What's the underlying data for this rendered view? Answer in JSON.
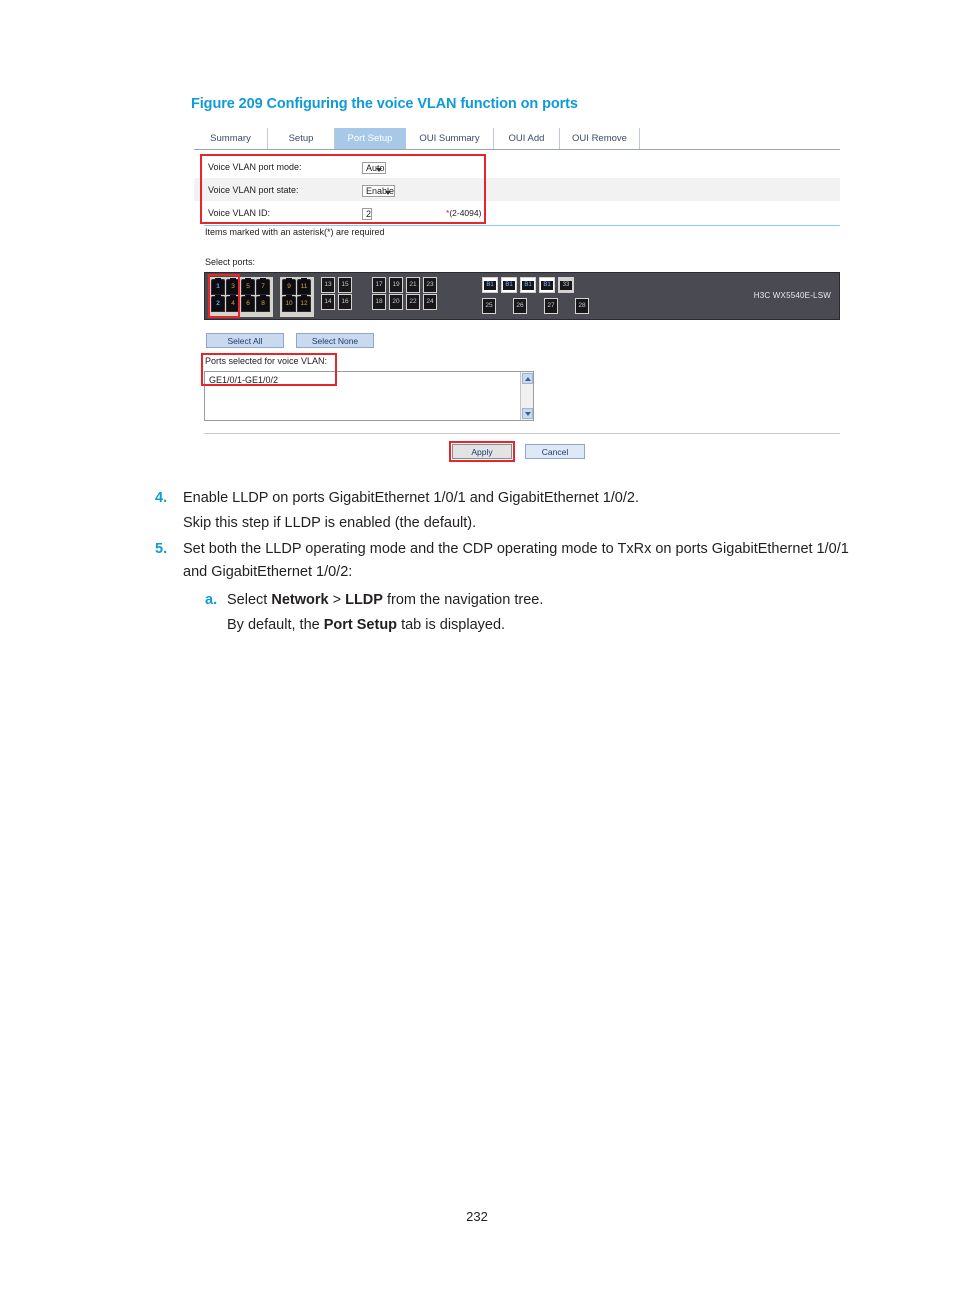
{
  "figure": {
    "caption": "Figure 209 Configuring the voice VLAN function on ports",
    "tabs": [
      {
        "label": "Summary",
        "active": false
      },
      {
        "label": "Setup",
        "active": false
      },
      {
        "label": "Port Setup",
        "active": true
      },
      {
        "label": "OUI Summary",
        "active": false
      },
      {
        "label": "OUI Add",
        "active": false
      },
      {
        "label": "OUI Remove",
        "active": false
      }
    ],
    "form": {
      "rows": [
        {
          "label": "Voice VLAN port mode:",
          "control": "select",
          "value": "Auto",
          "hint": ""
        },
        {
          "label": "Voice VLAN port state:",
          "control": "select",
          "value": "Enable",
          "hint": ""
        },
        {
          "label": "Voice VLAN ID:",
          "control": "text",
          "value": "2",
          "hint": "(2-4094)",
          "hint_star": "*"
        }
      ],
      "required_note": "Items marked with an asterisk(*) are required"
    },
    "ports": {
      "section_label": "Select ports:",
      "device_label": "H3C WX5540E-LSW",
      "groups": [
        {
          "type": "rj45",
          "shell": true,
          "columns": [
            {
              "top": "1",
              "bottom": "2",
              "top_selected": true,
              "bottom_selected": true
            },
            {
              "top": "3",
              "bottom": "4",
              "top_selected": false,
              "bottom_selected": false
            },
            {
              "top": "5",
              "bottom": "6",
              "top_selected": false,
              "bottom_selected": false
            },
            {
              "top": "7",
              "bottom": "8",
              "top_selected": false,
              "bottom_selected": false
            }
          ]
        },
        {
          "type": "rj45",
          "shell": true,
          "columns": [
            {
              "top": "9",
              "bottom": "10",
              "top_selected": false,
              "bottom_selected": false
            },
            {
              "top": "11",
              "bottom": "12",
              "top_selected": false,
              "bottom_selected": false
            }
          ]
        },
        {
          "type": "framed",
          "shell": false,
          "columns": [
            {
              "top": "13",
              "bottom": "14",
              "top_selected": false,
              "bottom_selected": false
            },
            {
              "top": "15",
              "bottom": "16",
              "top_selected": false,
              "bottom_selected": false
            }
          ]
        },
        {
          "type": "framed",
          "shell": false,
          "columns": [
            {
              "top": "17",
              "bottom": "18",
              "top_selected": false,
              "bottom_selected": false
            },
            {
              "top": "19",
              "bottom": "20",
              "top_selected": false,
              "bottom_selected": false
            },
            {
              "top": "21",
              "bottom": "22",
              "top_selected": false,
              "bottom_selected": false
            },
            {
              "top": "23",
              "bottom": "24",
              "top_selected": false,
              "bottom_selected": false
            }
          ]
        }
      ],
      "sfp_ports": [
        "B1",
        "B1",
        "B1",
        "B1"
      ],
      "uplink_port": "33",
      "bottom_row_ports": [
        "25",
        "26",
        "27",
        "28"
      ],
      "select_all_label": "Select All",
      "select_none_label": "Select None"
    },
    "selection": {
      "label": "Ports selected for voice VLAN:",
      "value": "GE1/0/1-GE1/0/2"
    },
    "actions": {
      "apply_label": "Apply",
      "cancel_label": "Cancel"
    }
  },
  "body": {
    "step4": {
      "num": "4.",
      "text": "Enable LLDP on ports GigabitEthernet 1/0/1 and GigabitEthernet 1/0/2.",
      "note": "Skip this step if LLDP is enabled (the default)."
    },
    "step5": {
      "num": "5.",
      "text_1": "Set both the LLDP operating mode and the CDP operating mode to TxRx on ports GigabitEthernet 1/0/1 and GigabitEthernet 1/0/2:",
      "sub_a": {
        "num": "a.",
        "prefix": "Select ",
        "bold_1": "Network",
        "middle": " > ",
        "bold_2": "LLDP",
        "suffix": " from the navigation tree."
      },
      "sub_a_note": {
        "prefix": "By default, the ",
        "bold": "Port Setup",
        "suffix": " tab is displayed."
      }
    }
  },
  "page_number": "232"
}
